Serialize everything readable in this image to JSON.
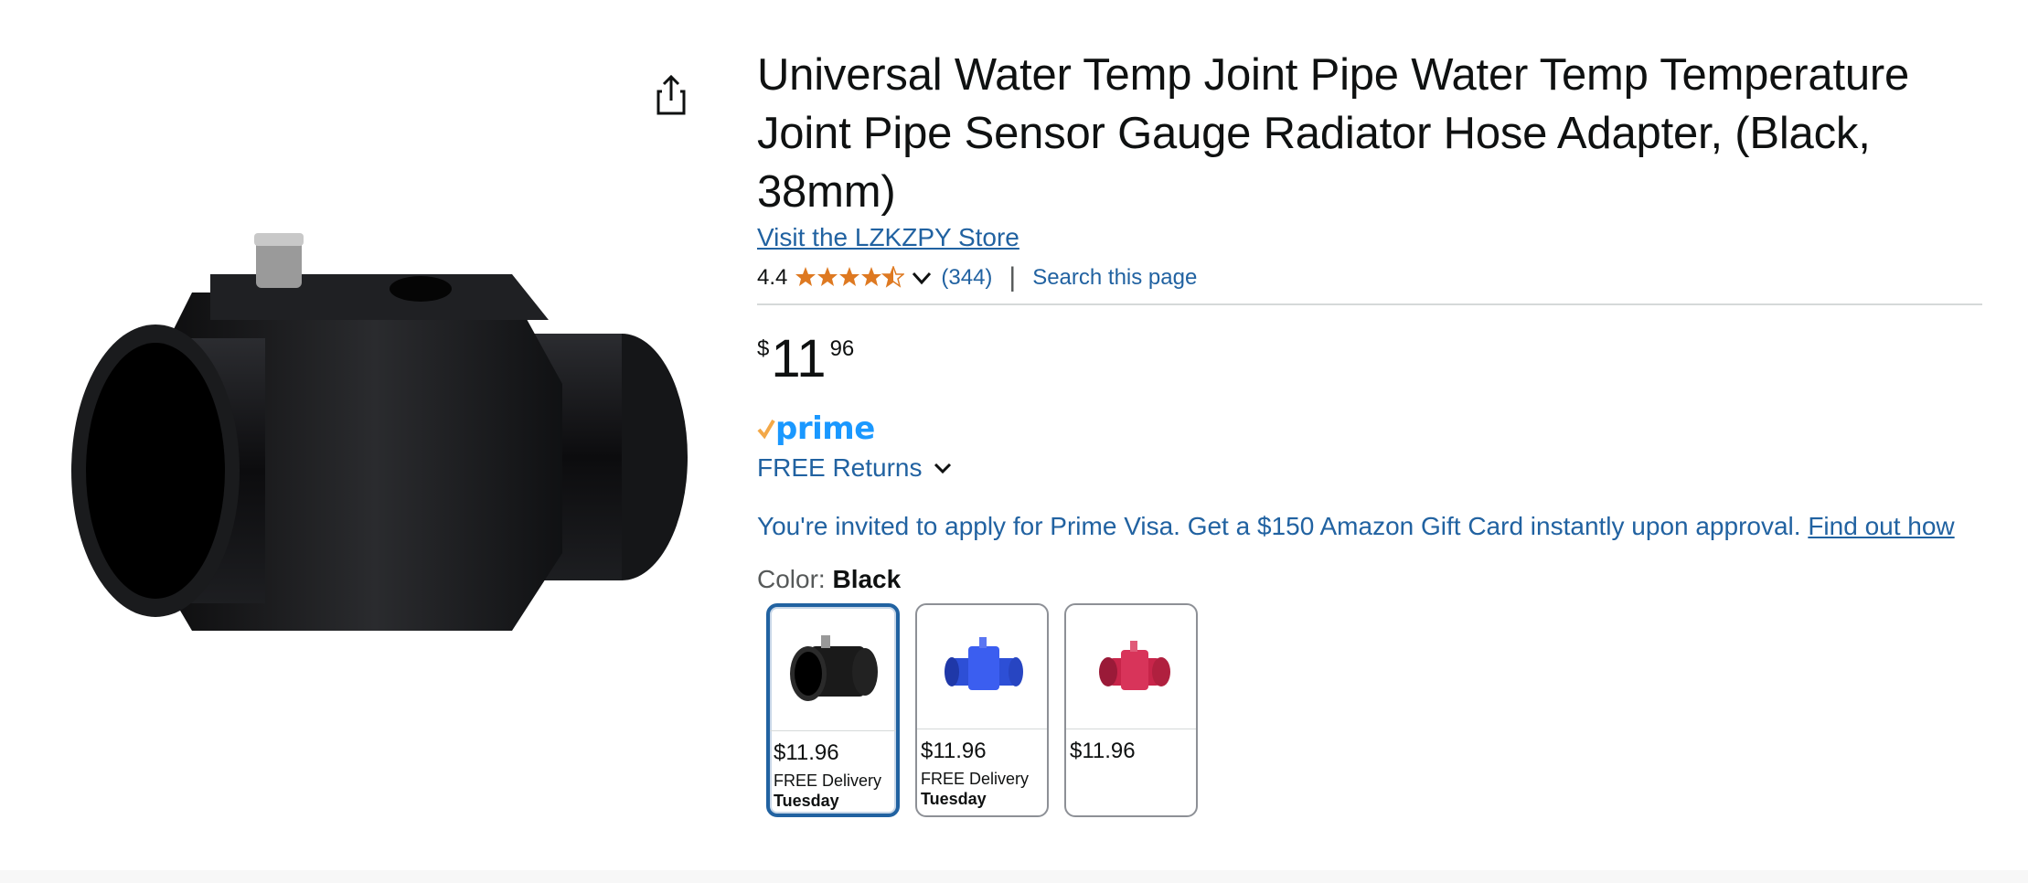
{
  "product": {
    "title": "Universal Water Temp Joint Pipe Water Temp Temperature Joint Pipe Sensor Gauge Radiator Hose Adapter, (Black, 38mm)",
    "store_link": "Visit the LZKZPY Store",
    "rating": "4.4",
    "rating_stars": 4.4,
    "review_count": "(344)",
    "search_page": "Search this page",
    "price": {
      "symbol": "$",
      "whole": "11",
      "fraction": "96"
    },
    "prime_label": "prime",
    "returns_label": "FREE Returns",
    "visa_text": "You're invited to apply for Prime Visa. Get a $150 Amazon Gift Card instantly upon approval. ",
    "visa_link": "Find out how",
    "color_label": "Color: ",
    "color_value": "Black",
    "swatches": [
      {
        "color": "Black",
        "price": "$11.96",
        "delivery": "FREE Delivery",
        "day": "Tuesday",
        "tint": "#111111",
        "selected": true
      },
      {
        "color": "Blue",
        "price": "$11.96",
        "delivery": "FREE Delivery",
        "day": "Tuesday",
        "tint": "#2d4fd6",
        "selected": false
      },
      {
        "color": "Red",
        "price": "$11.96",
        "delivery": "",
        "day": "",
        "tint": "#c8254a",
        "selected": false
      }
    ]
  },
  "icons": {
    "share": "share-icon",
    "star": "star-icon",
    "chevron": "chevron-down-icon",
    "prime_check": "check-icon"
  },
  "colors": {
    "link": "#2162a1",
    "star": "#f3a847",
    "prime": "#1a98ff",
    "selected_border": "#2162a1"
  }
}
